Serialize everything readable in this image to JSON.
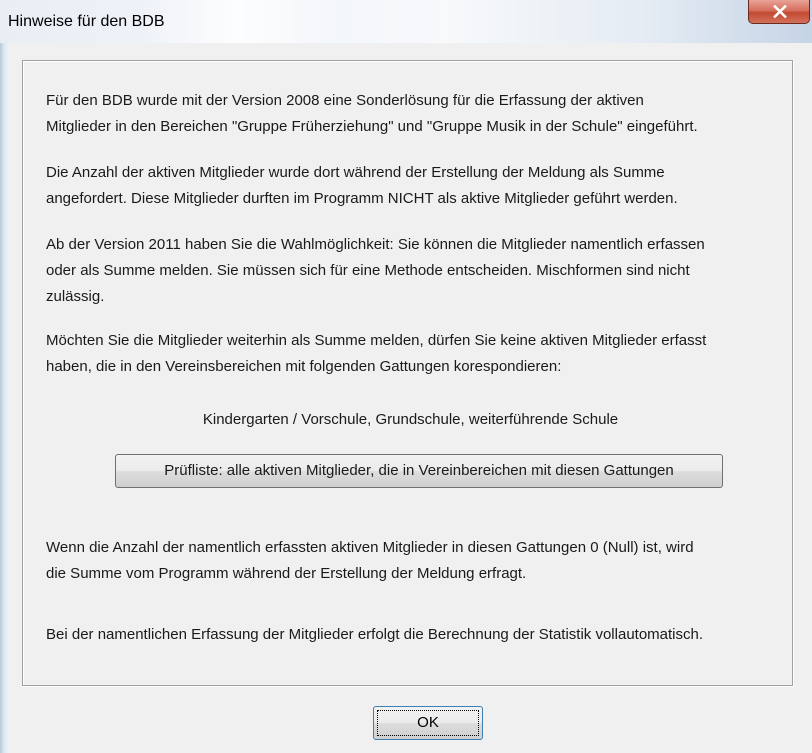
{
  "window": {
    "title": "Hinweise für den BDB"
  },
  "body": {
    "para1": [
      "Für den BDB wurde mit der Version 2008 eine Sonderlösung für die Erfassung der aktiven",
      "Mitglieder in den Bereichen \"Gruppe Früherziehung\" und \"Gruppe Musik in der Schule\" eingeführt."
    ],
    "para2": [
      "Die Anzahl der aktiven Mitglieder wurde dort während der Erstellung der Meldung als Summe",
      "angefordert. Diese Mitglieder durften im Programm NICHT als aktive Mitglieder geführt werden."
    ],
    "para3": [
      "Ab der Version 2011 haben Sie die Wahlmöglichkeit: Sie können die Mitglieder namentlich erfassen",
      "oder als Summe melden. Sie müssen sich für eine Methode entscheiden. Mischformen sind nicht",
      "zulässig."
    ],
    "para4": [
      "Möchten Sie die Mitglieder weiterhin als Summe melden, dürfen Sie keine aktiven Mitglieder erfasst",
      "haben, die in den Vereinsbereichen mit folgenden Gattungen korespondieren:"
    ],
    "categories_line": "Kindergarten / Vorschule, Grundschule, weiterführende Schule",
    "para5": [
      "Wenn die Anzahl der namentlich erfassten aktiven Mitglieder in diesen Gattungen 0 (Null) ist, wird",
      "die Summe vom Programm während der Erstellung der Meldung erfragt."
    ],
    "para6": "Bei der namentlichen Erfassung der Mitglieder erfolgt die Berechnung der Statistik vollautomatisch."
  },
  "buttons": {
    "check_list_label": "Prüfliste: alle aktiven Mitglieder, die in Vereinbereichen mit diesen Gattungen",
    "ok_label": "OK"
  },
  "icons": {
    "close": "close-icon"
  },
  "colors": {
    "close_button": "#c24a33",
    "default_button_border": "#3c7fb1"
  }
}
